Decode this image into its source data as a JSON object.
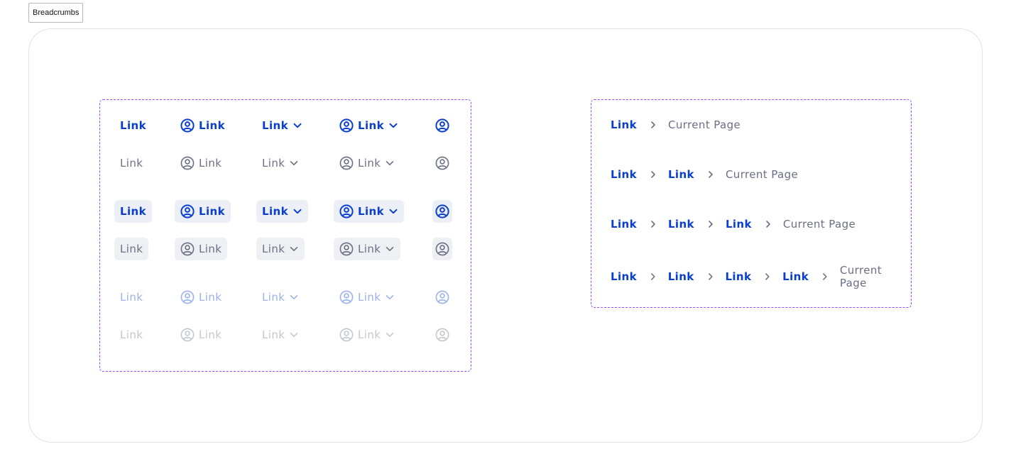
{
  "page_tag": "Breadcrumbs",
  "colors": {
    "active": "#0a3fcc",
    "default": "#6b6f83",
    "disabled": "#9bb2ea",
    "muted": "#c5c7d0",
    "frame_border": "#9747ff"
  },
  "variants": {
    "link_label": "Link",
    "icons": {
      "user": "user-circle-icon",
      "chevron": "chevron-down-icon"
    }
  },
  "breadcrumbs": {
    "rows": [
      {
        "links": [
          "Link"
        ],
        "current": "Current Page"
      },
      {
        "links": [
          "Link",
          "Link"
        ],
        "current": "Current Page"
      },
      {
        "links": [
          "Link",
          "Link",
          "Link"
        ],
        "current": "Current Page"
      },
      {
        "links": [
          "Link",
          "Link",
          "Link",
          "Link"
        ],
        "current": "Current Page"
      }
    ],
    "separator_icon": "chevron-right-icon"
  }
}
